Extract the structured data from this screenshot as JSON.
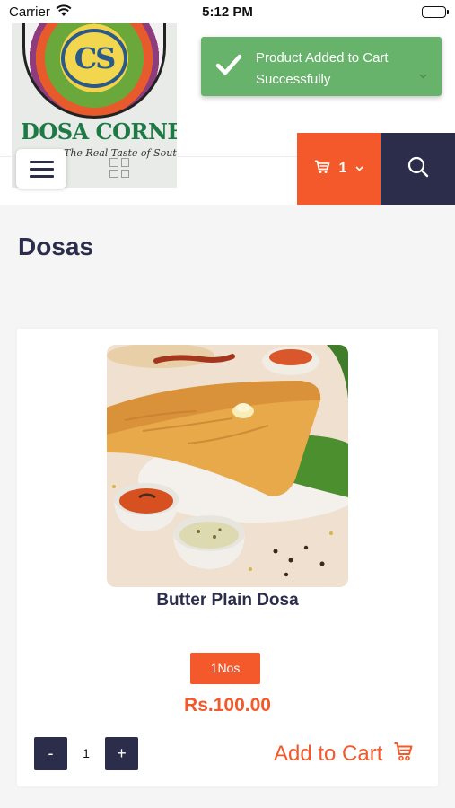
{
  "status_bar": {
    "carrier": "Carrier",
    "time": "5:12 PM"
  },
  "brand": {
    "logo_monogram": "CS",
    "logo_name": "DOSA CORNER",
    "logo_tagline": "The Real Taste of South"
  },
  "header": {
    "cart_count": "1",
    "colors": {
      "accent": "#f3592a",
      "navy": "#2b2d4a"
    }
  },
  "toast": {
    "message": "Product Added to Cart Successfully",
    "color": "#68b36b"
  },
  "page": {
    "title": "Dosas"
  },
  "product": {
    "name": "Butter Plain Dosa",
    "unit": "1Nos",
    "price": "Rs.100.00",
    "quantity": "1",
    "minus_label": "-",
    "plus_label": "+",
    "add_to_cart_label": "Add to Cart"
  },
  "icons": [
    "wifi-icon",
    "battery-icon",
    "hamburger-menu-icon",
    "grid-view-icon",
    "cart-icon",
    "chevron-down-icon",
    "search-icon",
    "checkmark-icon"
  ]
}
